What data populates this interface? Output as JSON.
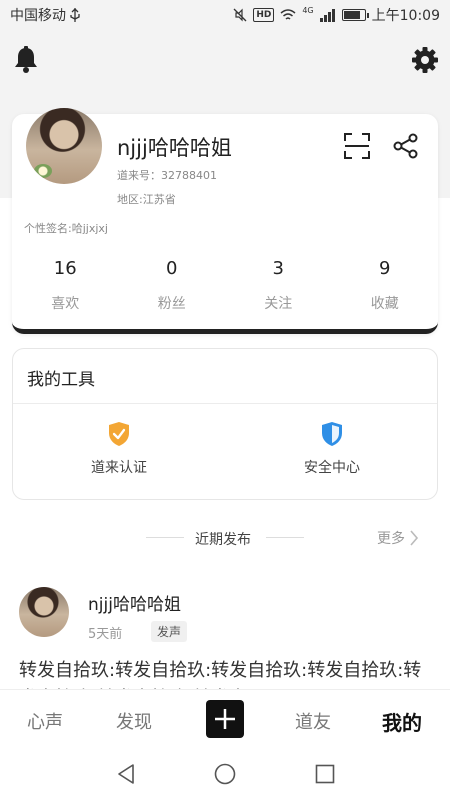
{
  "status_bar": {
    "carrier": "中国移动",
    "network": "4G",
    "hd": "HD",
    "time": "上午10:09",
    "battery_level": 0.85
  },
  "profile": {
    "nickname": "njjj哈哈哈姐",
    "id_line": "道来号：32788401",
    "region_line": "地区:江苏省",
    "signature_line": "个性签名:哈jjxjxj",
    "stats": [
      {
        "value": "16",
        "label": "喜欢"
      },
      {
        "value": "0",
        "label": "粉丝"
      },
      {
        "value": "3",
        "label": "关注"
      },
      {
        "value": "9",
        "label": "收藏"
      }
    ]
  },
  "tools": {
    "title": "我的工具",
    "items": [
      {
        "label": "道来认证",
        "icon": "verified-shield-icon",
        "color": "#f3a634"
      },
      {
        "label": "安全中心",
        "icon": "security-shield-icon",
        "color": "#2f8fe6"
      }
    ]
  },
  "recent": {
    "title": "近期发布",
    "more": "更多"
  },
  "post": {
    "author": "njjj哈哈哈姐",
    "time": "5天前",
    "tag": "发声",
    "content": "转发自拾玖:转发自拾玖:转发自拾玖:转发自拾玖:转发自拾玖:转发自拾玖:转发自"
  },
  "bottom_nav": {
    "items": [
      {
        "label": "心声"
      },
      {
        "label": "发现"
      },
      {
        "label": "道友"
      },
      {
        "label": "我的"
      }
    ],
    "active": "我的"
  },
  "colors": {
    "header_bg": "#f3f3f3",
    "accent_dark": "#111111"
  }
}
